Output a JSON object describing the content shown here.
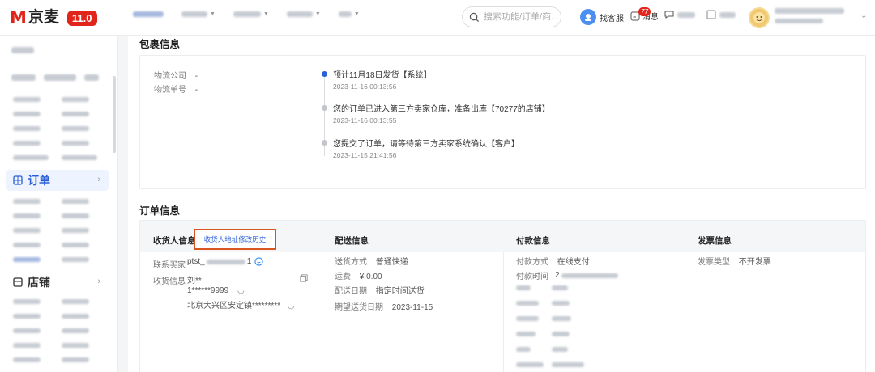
{
  "header": {
    "logo_m": "M",
    "logo_text": "京麦",
    "version": "11.0",
    "search_placeholder": "搜索功能/订单/商...",
    "customer_service_label": "找客服",
    "message_label": "消息",
    "message_count": "77",
    "account_name": "[blurred account name]"
  },
  "sidebar": {
    "order_section_label": "订单",
    "shop_section_label": "店铺",
    "active_section": "订单"
  },
  "package_info": {
    "section_title": "包裹信息",
    "logistics_company_label": "物流公司",
    "logistics_company_value": "-",
    "tracking_number_label": "物流单号",
    "tracking_number_value": "-",
    "timeline": [
      {
        "text": "预计11月18日发货【系统】",
        "time": "2023-11-16 00:13:56"
      },
      {
        "text": "您的订单已进入第三方卖家仓库，准备出库【70277的店铺】",
        "time": "2023-11-16 00:13:55"
      },
      {
        "text": "您提交了订单，请等待第三方卖家系统确认【客户】",
        "time": "2023-11-15 21:41:56"
      }
    ]
  },
  "order_info": {
    "section_title": "订单信息",
    "consignee": {
      "title": "收货人信息",
      "address_history_link": "收货人地址修改历史",
      "buyer_label": "联系买家",
      "buyer_prefix": "ptst_",
      "buyer_suffix": "1",
      "receiver_label": "收货信息",
      "receiver_name": "刘**",
      "receiver_phone": "1******9999",
      "receiver_address": "北京大兴区安定镇*********"
    },
    "delivery": {
      "title": "配送信息",
      "method_label": "送货方式",
      "method_value": "普通快递",
      "fee_label": "运费",
      "fee_value": "¥ 0.00",
      "date_label": "配送日期",
      "date_value": "指定时间送货",
      "expected_label": "期望送货日期",
      "expected_value": "2023-11-15"
    },
    "payment": {
      "title": "付款信息",
      "method_label": "付款方式",
      "method_value": "在线支付",
      "time_label": "付款时间",
      "time_value_prefix": "2"
    },
    "invoice": {
      "title": "发票信息",
      "type_label": "发票类型",
      "type_value": "不开发票"
    }
  },
  "colors": {
    "brand_red": "#e1251b",
    "link_blue": "#2a5fd8",
    "highlight_orange": "#d9541e"
  }
}
